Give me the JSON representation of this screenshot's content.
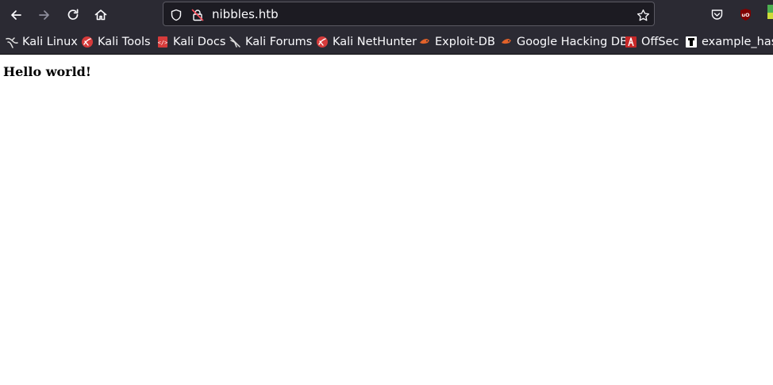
{
  "toolbar": {
    "back_icon": "arrow-left-icon",
    "forward_icon": "arrow-right-icon",
    "reload_icon": "reload-icon",
    "home_icon": "home-icon"
  },
  "urlbar": {
    "url": "nibbles.htb",
    "shield_icon": "tracking-shield-icon",
    "lock_icon": "insecure-lock-icon",
    "bookmark_star_icon": "star-icon"
  },
  "extensions": {
    "pocket_icon": "pocket-icon",
    "ublock_icon": "ublock-origin-icon"
  },
  "bookmarks": [
    {
      "label": "Kali Linux",
      "icon": "kali-dragon-icon"
    },
    {
      "label": "Kali Tools",
      "icon": "kali-tools-icon"
    },
    {
      "label": "Kali Docs",
      "icon": "kali-docs-icon"
    },
    {
      "label": "Kali Forums",
      "icon": "kali-forums-icon"
    },
    {
      "label": "Kali NetHunter",
      "icon": "kali-nethunter-icon"
    },
    {
      "label": "Exploit-DB",
      "icon": "exploit-db-icon"
    },
    {
      "label": "Google Hacking DB",
      "icon": "ghdb-icon"
    },
    {
      "label": "OffSec",
      "icon": "offsec-icon"
    },
    {
      "label": "example_hash",
      "icon": "hash-icon"
    }
  ],
  "page": {
    "body_text": "Hello world!"
  },
  "colors": {
    "toolbar_bg": "#2b2a33",
    "urlbar_bg": "#1c1b22",
    "text_light": "#fbfbfe",
    "page_bg": "#ffffff"
  }
}
